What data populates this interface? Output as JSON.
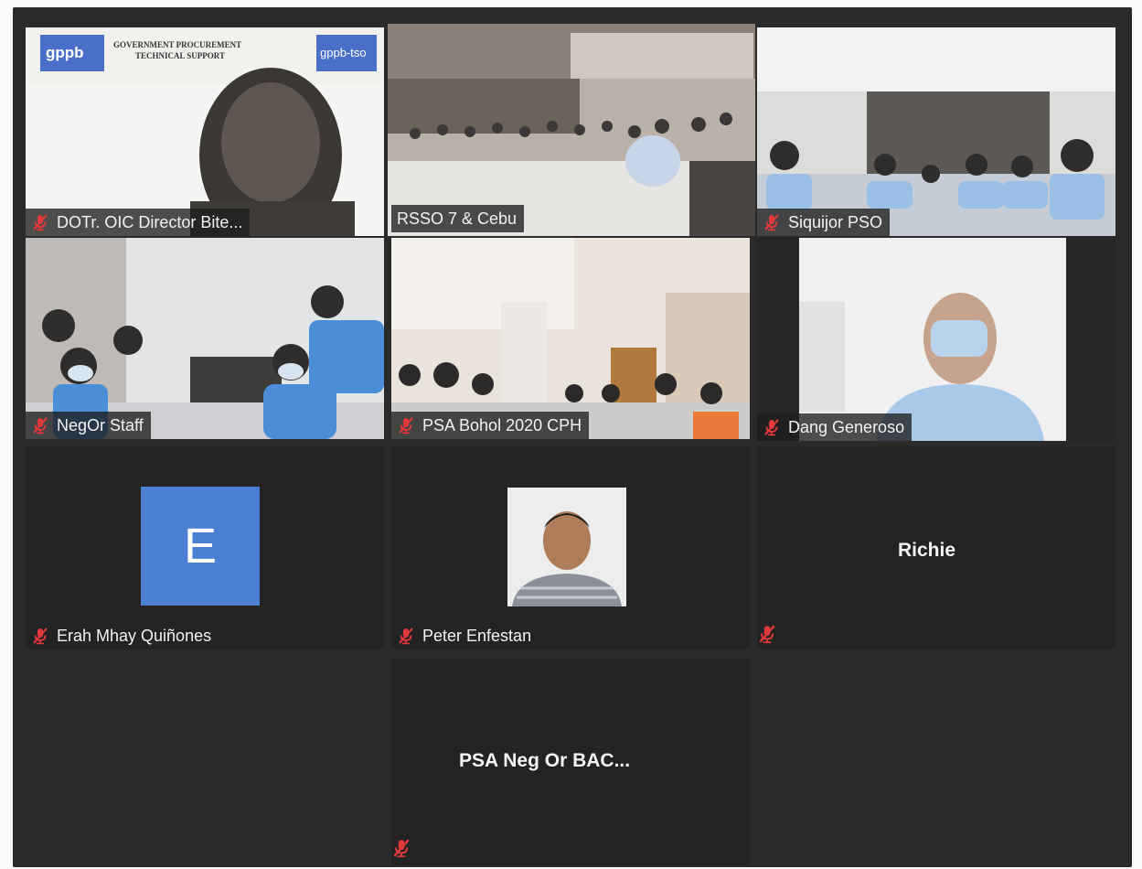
{
  "app": {
    "mic_muted_icon": "mic-muted-icon",
    "muted_color": "#e0383b",
    "active_speaker_border": "#dfe36a"
  },
  "tiles": {
    "dotr": {
      "name": "DOTr. OIC Director Bite...",
      "banner_title": "GOVERNMENT PROCUREMENT",
      "banner_subtitle": "TECHNICAL SUPPORT",
      "logo_left": "gppb",
      "logo_right": "gppb-tso"
    },
    "rsso": {
      "name": "RSSO 7 & Cebu"
    },
    "siquijor": {
      "name": "Siquijor PSO"
    },
    "negor": {
      "name": "NegOr Staff"
    },
    "psa_bohol": {
      "name": "PSA Bohol 2020 CPH"
    },
    "dang": {
      "name": "Dang Generoso"
    },
    "erah": {
      "name": "Erah Mhay Quiñones",
      "initial": "E"
    },
    "peter": {
      "name": "Peter Enfestan"
    },
    "richie": {
      "name": "Richie"
    },
    "psa_negor": {
      "name": "PSA Neg Or BAC..."
    }
  }
}
